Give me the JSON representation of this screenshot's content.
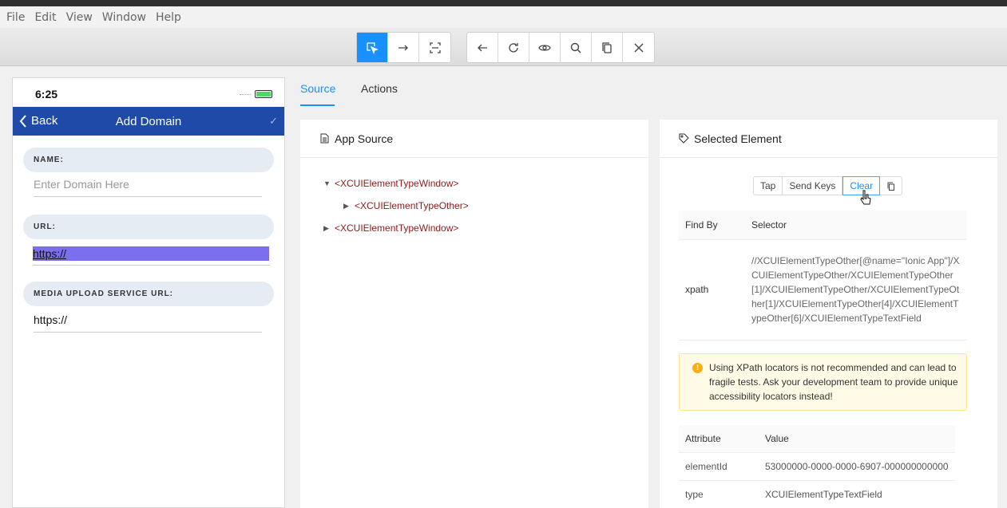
{
  "menubar": {
    "items": [
      "File",
      "Edit",
      "View",
      "Window",
      "Help"
    ]
  },
  "toolbar": {
    "mode_buttons": [
      "select-elements-icon",
      "swipe-arrow-icon",
      "tap-coordinates-icon"
    ],
    "nav_buttons": [
      "back-arrow-icon",
      "refresh-icon",
      "eye-icon",
      "search-icon",
      "copy-icon",
      "close-icon"
    ]
  },
  "phone": {
    "time": "6:25",
    "nav_back": "Back",
    "nav_title": "Add Domain",
    "nav_check": "✓",
    "fields": [
      {
        "header": "NAME:",
        "value": "Enter Domain Here",
        "is_placeholder": true
      },
      {
        "header": "URL:",
        "value": "https://",
        "selected": true
      },
      {
        "header": "MEDIA UPLOAD SERVICE URL:",
        "value": "https://"
      }
    ]
  },
  "tabs": {
    "source": "Source",
    "actions": "Actions"
  },
  "app_source": {
    "title": "App Source",
    "nodes": [
      {
        "label": "<XCUIElementTypeWindow>",
        "expanded": true
      },
      {
        "label": "<XCUIElementTypeOther>",
        "expanded": false
      },
      {
        "label": "<XCUIElementTypeWindow>",
        "expanded": false
      }
    ]
  },
  "selected_element": {
    "title": "Selected Element",
    "actions": [
      "Tap",
      "Send Keys",
      "Clear"
    ],
    "find_by_header": "Find By",
    "selector_header": "Selector",
    "find_by": "xpath",
    "selector": "//XCUIElementTypeOther[@name=\"Ionic App\"]/XCUIElementTypeOther/XCUIElementTypeOther[1]/XCUIElementTypeOther/XCUIElementTypeOther[1]/XCUIElementTypeOther[4]/XCUIElementTypeOther[6]/XCUIElementTypeTextField",
    "warning": "Using XPath locators is not recommended and can lead to fragile tests. Ask your development team to provide unique accessibility locators instead!",
    "attr_header": "Attribute",
    "value_header": "Value",
    "attributes": [
      {
        "name": "elementId",
        "value": "53000000-0000-0000-6907-000000000000"
      },
      {
        "name": "type",
        "value": "XCUIElementTypeTextField"
      }
    ]
  },
  "colors": {
    "accent": "#1890ff",
    "nav": "#1f4aa8",
    "selection": "#7b6ff0",
    "tag": "#8b1a1a"
  }
}
